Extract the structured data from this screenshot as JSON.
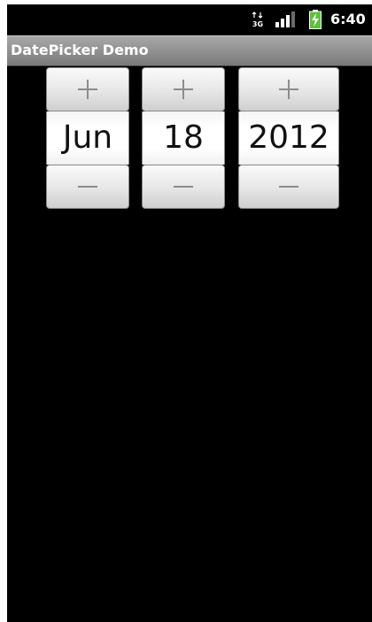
{
  "status_bar": {
    "network_icon": "3g-data-icon",
    "network_label": "3G",
    "signal_icon": "signal-strength-icon",
    "battery_icon": "battery-charging-icon",
    "time": "6:40"
  },
  "app_bar": {
    "title": "DatePicker Demo"
  },
  "date_picker": {
    "month": {
      "value": "Jun",
      "increment_icon": "plus-icon",
      "decrement_icon": "minus-icon"
    },
    "day": {
      "value": "18",
      "increment_icon": "plus-icon",
      "decrement_icon": "minus-icon"
    },
    "year": {
      "value": "2012",
      "increment_icon": "plus-icon",
      "decrement_icon": "minus-icon"
    }
  },
  "colors": {
    "background": "#000000",
    "title_bar": "#8e8e8e",
    "status_text": "#ffffff",
    "battery_charging": "#5fc13a",
    "picker_text": "#111111"
  }
}
